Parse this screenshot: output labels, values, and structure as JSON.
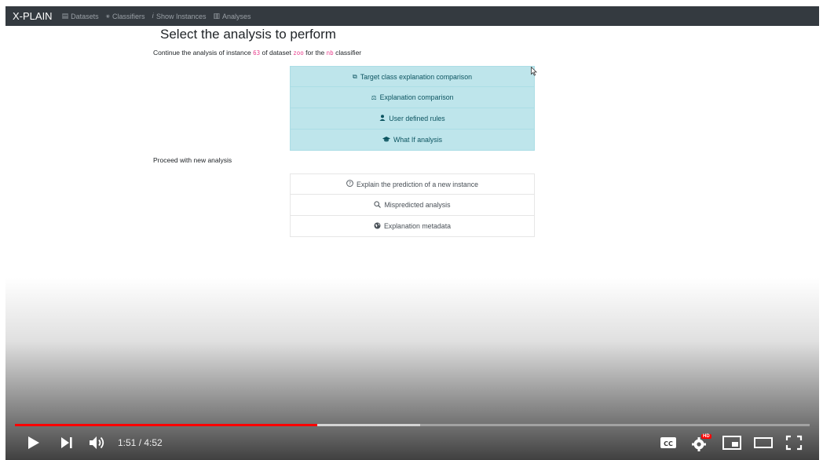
{
  "navbar": {
    "brand": "X-PLAIN",
    "items": [
      {
        "label": "Datasets",
        "icon": "table-icon"
      },
      {
        "label": "Classifiers",
        "icon": "robot-icon"
      },
      {
        "label": "Show Instances",
        "icon": "info-icon"
      },
      {
        "label": "Analyses",
        "icon": "bar-chart-icon"
      }
    ]
  },
  "main": {
    "title": "Select the analysis to perform",
    "continue_text": {
      "prefix": "Continue the analysis of instance",
      "instance": "63",
      "middle": "of dataset",
      "dataset": "zoo",
      "for_the": "for the",
      "classifier": "nb",
      "suffix": "classifier"
    },
    "primary_list": [
      {
        "label": "Target class explanation comparison",
        "icon": "compare-icon"
      },
      {
        "label": "Explanation comparison",
        "icon": "balance-scale-icon"
      },
      {
        "label": "User defined rules",
        "icon": "user-icon"
      },
      {
        "label": "What If analysis",
        "icon": "graduation-cap-icon"
      }
    ],
    "proceed_label": "Proceed with new analysis",
    "secondary_list": [
      {
        "label": "Explain the prediction of a new instance",
        "icon": "question-circle-icon"
      },
      {
        "label": "Mispredicted analysis",
        "icon": "search-icon"
      },
      {
        "label": "Explanation metadata",
        "icon": "globe-icon"
      }
    ]
  },
  "player": {
    "current_time": "1:51",
    "separator": " / ",
    "duration": "4:52",
    "played_fraction": 0.38,
    "buffered_fraction": 0.51,
    "hd_badge": "HD",
    "accent_color": "#ff0000",
    "icons": [
      "play-icon",
      "next-icon",
      "volume-icon",
      "captions-icon",
      "settings-icon",
      "miniplayer-icon",
      "theater-icon",
      "fullscreen-icon"
    ],
    "cc_label": "CC"
  }
}
